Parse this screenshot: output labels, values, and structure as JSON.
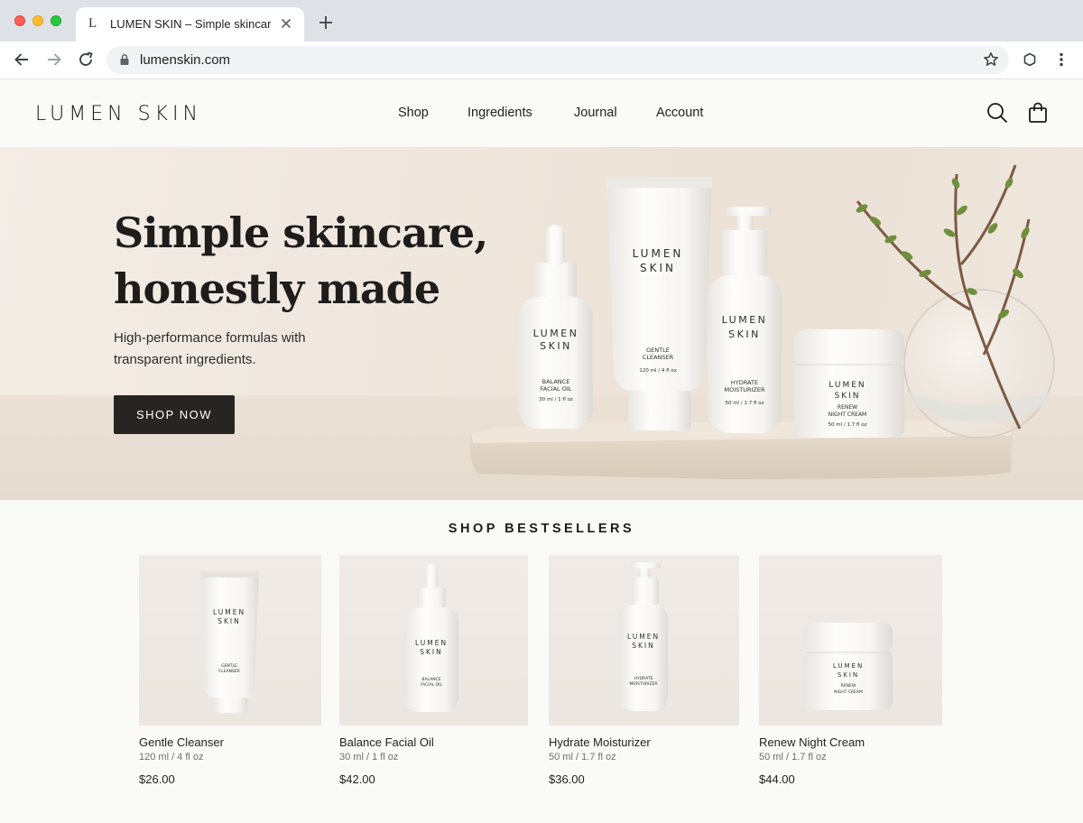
{
  "browser": {
    "tab_favicon": "L",
    "tab_title": "LUMEN SKIN – Simple skincare, honestly made",
    "url": "lumenskin.com",
    "icons": [
      "back-arrow-icon",
      "forward-arrow-icon",
      "reload-icon",
      "lock-icon",
      "star-icon",
      "extension-icon",
      "kebab-menu-icon",
      "close-icon",
      "plus-icon"
    ]
  },
  "header": {
    "logo": "LUMEN SKIN",
    "nav": [
      {
        "label": "Shop"
      },
      {
        "label": "Ingredients"
      },
      {
        "label": "Journal"
      },
      {
        "label": "Account"
      }
    ],
    "icons": [
      "search-icon",
      "shopping-bag-icon"
    ]
  },
  "hero": {
    "title_line1": "Simple skincare,",
    "title_line2": "honestly made",
    "subtitle": "High-performance formulas with transparent ingredients.",
    "cta": "SHOP NOW",
    "products": [
      {
        "brand1": "LUMEN",
        "brand2": "SKIN",
        "name1": "BALANCE",
        "name2": "FACIAL OIL",
        "size": "30 ml / 1 fl oz"
      },
      {
        "brand1": "LUMEN",
        "brand2": "SKIN",
        "name1": "GENTLE",
        "name2": "CLEANSER",
        "size": "120 ml / 4 fl oz"
      },
      {
        "brand1": "LUMEN",
        "brand2": "SKIN",
        "name1": "HYDRATE",
        "name2": "MOISTURIZER",
        "size": "50 ml / 1.7 fl oz"
      },
      {
        "brand1": "LUMEN",
        "brand2": "SKIN",
        "name1": "RENEW",
        "name2": "NIGHT CREAM",
        "size": "50 ml / 1.7 fl oz"
      }
    ]
  },
  "bestsellers": {
    "title": "SHOP BESTSELLERS",
    "items": [
      {
        "name": "Gentle Cleanser",
        "size": "120 ml / 4 fl oz",
        "price": "$26.00",
        "label1": "GENTLE",
        "label2": "CLEANSER"
      },
      {
        "name": "Balance Facial Oil",
        "size": "30 ml / 1 fl oz",
        "price": "$42.00",
        "label1": "BALANCE",
        "label2": "FACIAL OIL"
      },
      {
        "name": "Hydrate Moisturizer",
        "size": "50 ml / 1.7 fl oz",
        "price": "$36.00",
        "label1": "HYDRATE",
        "label2": "MOISTURIZER"
      },
      {
        "name": "Renew Night Cream",
        "size": "50 ml / 1.7 fl oz",
        "price": "$44.00",
        "label1": "RENEW",
        "label2": "NIGHT CREAM"
      }
    ]
  },
  "colors": {
    "ink": "#1c1c1c",
    "cta_bg": "#262523",
    "hero_bg": "#efe6dd",
    "page_bg": "#fafaf9"
  }
}
